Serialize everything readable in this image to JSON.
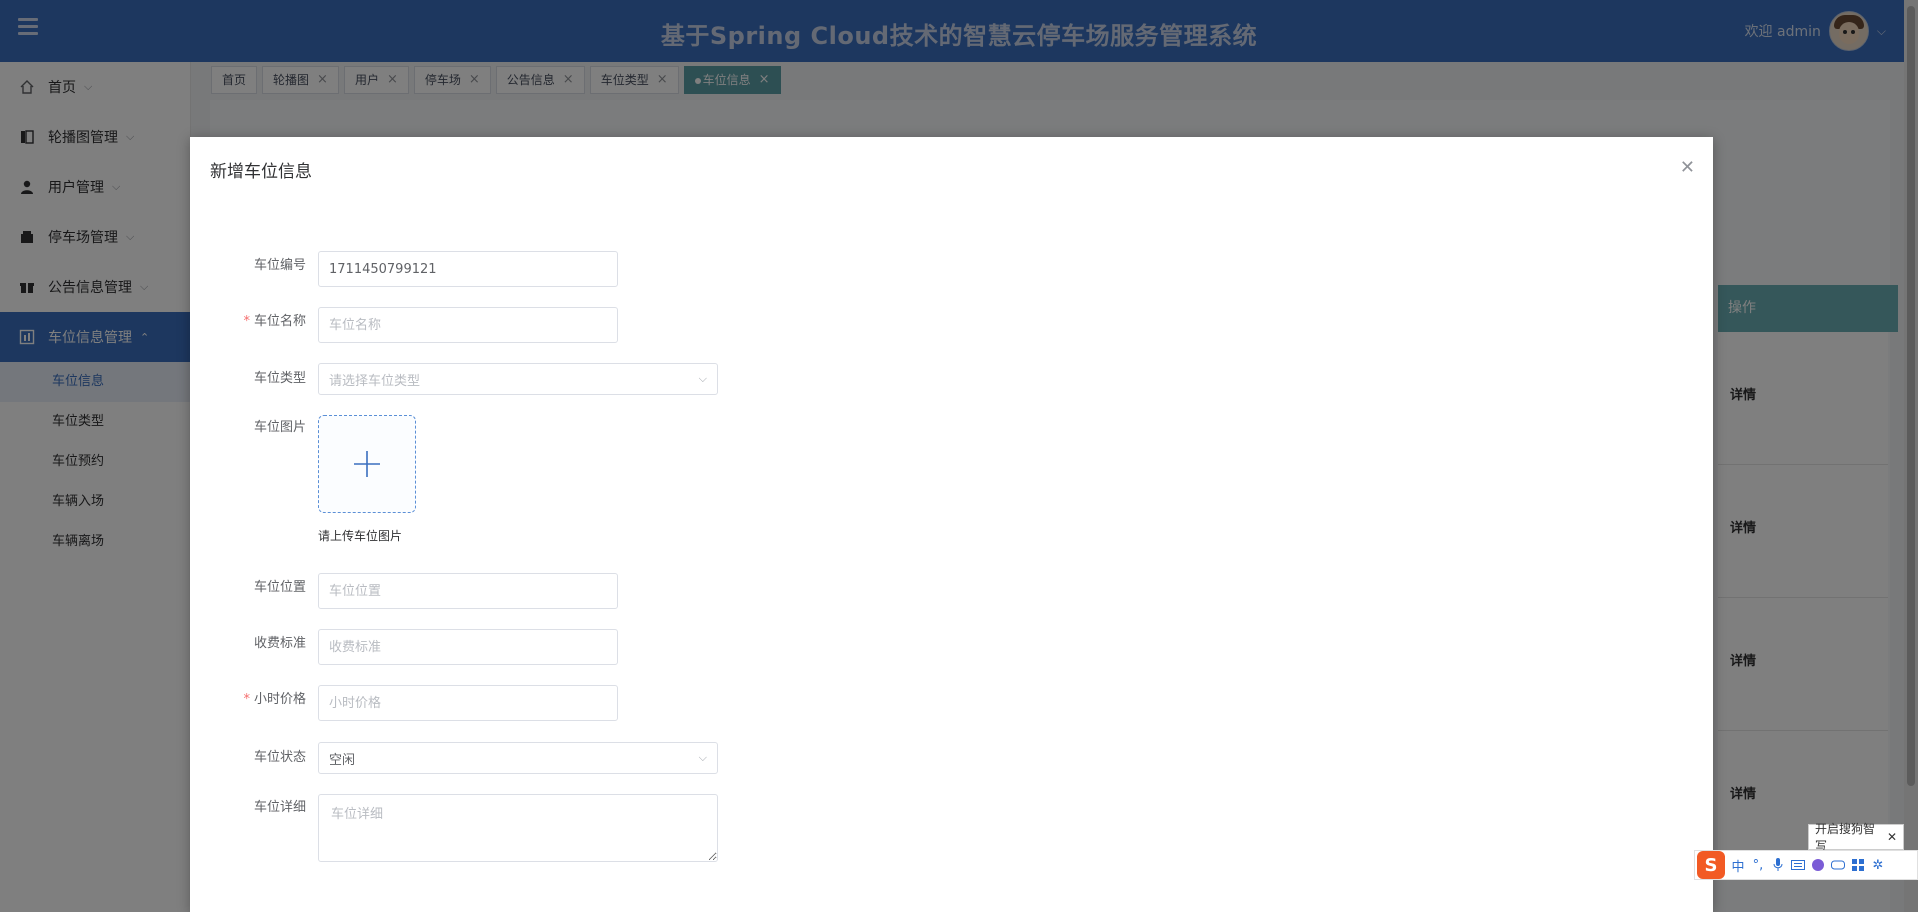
{
  "header": {
    "title": "基于Spring Cloud技术的智慧云停车场服务管理系统",
    "welcome": "欢迎 admin"
  },
  "sidebar": {
    "items": [
      {
        "label": "首页",
        "icon": "home-icon"
      },
      {
        "label": "轮播图管理",
        "icon": "book-icon"
      },
      {
        "label": "用户管理",
        "icon": "user-icon"
      },
      {
        "label": "停车场管理",
        "icon": "building-icon"
      },
      {
        "label": "公告信息管理",
        "icon": "gift-icon"
      },
      {
        "label": "车位信息管理",
        "icon": "parking-icon",
        "expanded": true
      }
    ],
    "sub_items": [
      "车位信息",
      "车位类型",
      "车位预约",
      "车辆入场",
      "车辆离场"
    ],
    "active_sub": "车位信息"
  },
  "tabs": [
    {
      "label": "首页",
      "closable": false
    },
    {
      "label": "轮播图",
      "closable": true
    },
    {
      "label": "用户",
      "closable": true
    },
    {
      "label": "停车场",
      "closable": true
    },
    {
      "label": "公告信息",
      "closable": true
    },
    {
      "label": "车位类型",
      "closable": true
    },
    {
      "label": "车位信息",
      "closable": true,
      "active": true
    }
  ],
  "background": {
    "table_header": "操作",
    "row_action": "详情"
  },
  "dialog": {
    "title": "新增车位信息",
    "fields": {
      "code": {
        "label": "车位编号",
        "value": "1711450799121"
      },
      "name": {
        "label": "车位名称",
        "placeholder": "车位名称",
        "required": true
      },
      "type": {
        "label": "车位类型",
        "placeholder": "请选择车位类型"
      },
      "image": {
        "label": "车位图片",
        "hint": "请上传车位图片"
      },
      "location": {
        "label": "车位位置",
        "placeholder": "车位位置"
      },
      "fee_standard": {
        "label": "收费标准",
        "placeholder": "收费标准"
      },
      "hourly_price": {
        "label": "小时价格",
        "placeholder": "小时价格",
        "required": true
      },
      "status": {
        "label": "车位状态",
        "value": "空闲"
      },
      "detail": {
        "label": "车位详细",
        "placeholder": "车位详细"
      }
    }
  },
  "ime": {
    "tip": "开启搜狗智写",
    "mode": "中"
  },
  "colors": {
    "primary": "#3a6fbf",
    "active_tab": "#5b9ea6",
    "required": "#f56c6c"
  }
}
